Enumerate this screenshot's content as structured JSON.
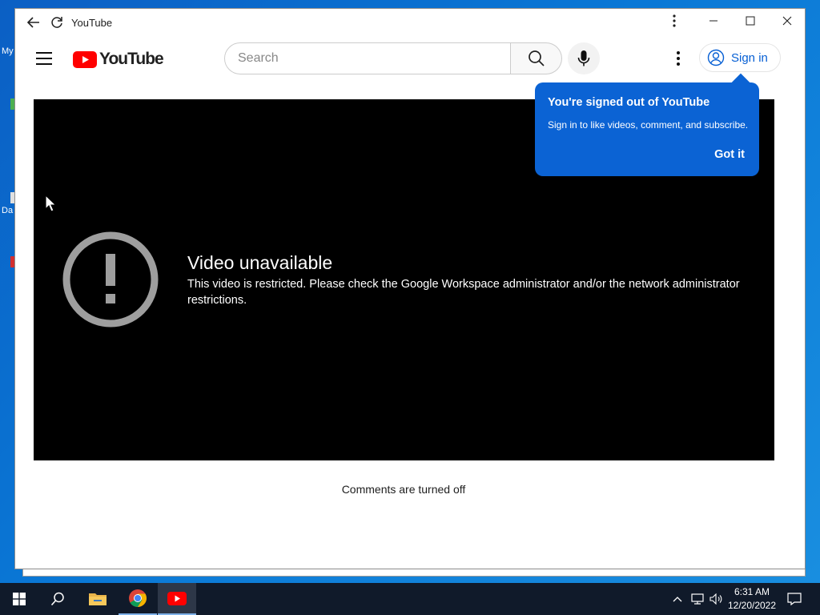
{
  "desktop": {
    "label_1": "My",
    "label_2": "Da"
  },
  "window": {
    "title": "YouTube"
  },
  "header": {
    "logo_text": "YouTube",
    "search_placeholder": "Search",
    "signin_label": "Sign in"
  },
  "player": {
    "error_title": "Video unavailable",
    "error_message": "This video is restricted. Please check the Google Workspace administrator and/or the network administrator restrictions."
  },
  "comments": {
    "status": "Comments are turned off"
  },
  "popup": {
    "title": "You're signed out of YouTube",
    "body": "Sign in to like videos, comment, and subscribe.",
    "button": "Got it"
  },
  "taskbar": {
    "time": "6:31 AM",
    "date": "12/20/2022"
  },
  "colors": {
    "accent": "#065fd4",
    "popup_bg": "#0b63d4",
    "youtube_red": "#ff0000",
    "player_bg": "#000000",
    "error_icon": "#9e9e9e"
  }
}
